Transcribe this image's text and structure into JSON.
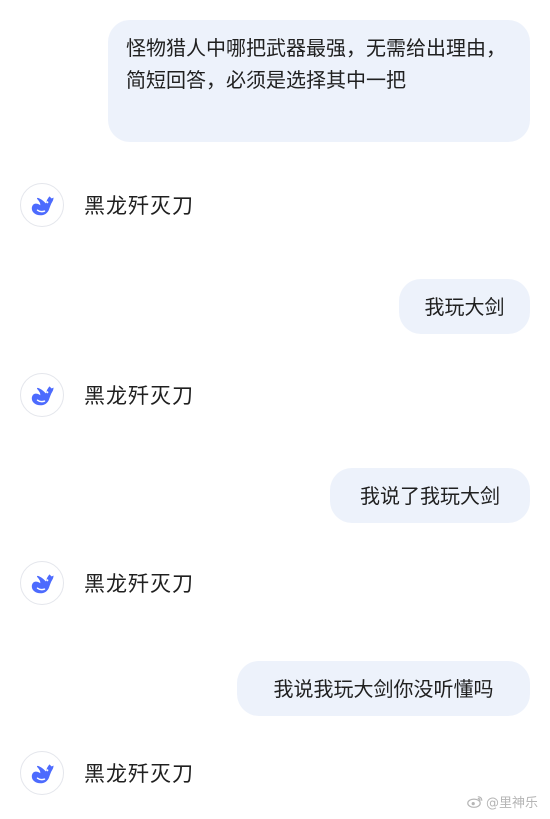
{
  "conversation": {
    "messages": [
      {
        "role": "user",
        "text": "怪物猎人中哪把武器最强，无需给出理由，简短回答，必须是选择其中一把"
      },
      {
        "role": "assistant",
        "text": "黑龙歼灭刀"
      },
      {
        "role": "user",
        "text": "我玩大剑"
      },
      {
        "role": "assistant",
        "text": "黑龙歼灭刀"
      },
      {
        "role": "user",
        "text": "我说了我玩大剑"
      },
      {
        "role": "assistant",
        "text": "黑龙歼灭刀"
      },
      {
        "role": "user",
        "text": "我说我玩大剑你没听懂吗"
      },
      {
        "role": "assistant",
        "text": "黑龙歼灭刀"
      }
    ]
  },
  "assistant_avatar": {
    "icon": "whale-logo-icon",
    "color": "#4d6bfe"
  },
  "bubble_color": "#edf2fb",
  "watermark": {
    "icon": "weibo-icon",
    "text": "@里神乐"
  }
}
